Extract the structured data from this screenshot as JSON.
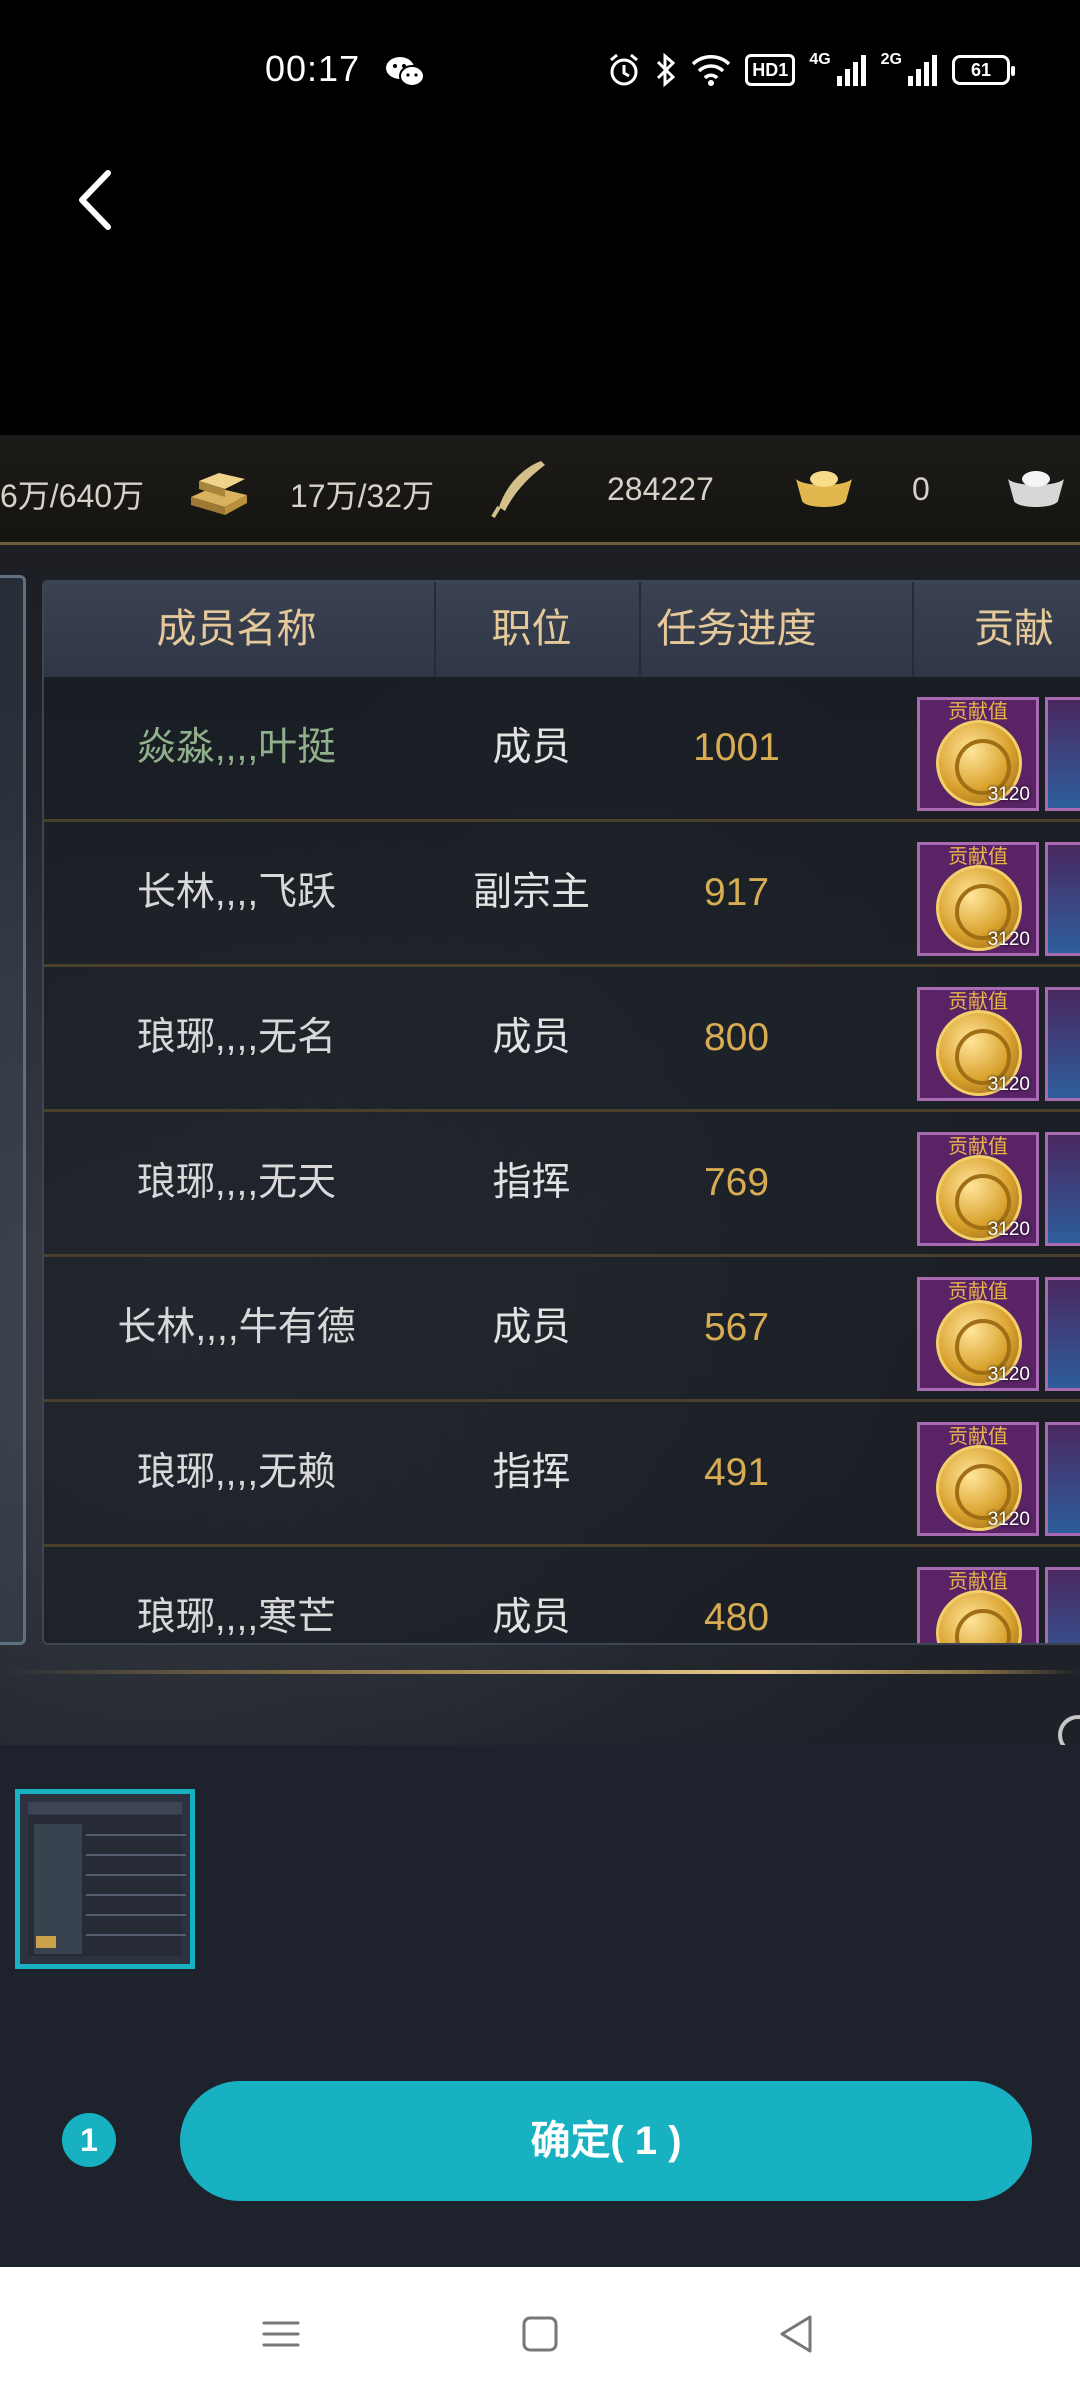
{
  "status_bar": {
    "time": "00:17",
    "network_4g": "4G",
    "network_2g": "2G",
    "battery": "61",
    "hd": "HD1"
  },
  "resources": {
    "r1": "6万/640万",
    "r2": "17万/32万",
    "r3": "284227",
    "r4": "0"
  },
  "table": {
    "headers": [
      "成员名称",
      "职位",
      "任务进度",
      "贡献"
    ],
    "medal_label": "贡献值",
    "rows": [
      {
        "name": "焱淼,,,,叶挺",
        "role": "成员",
        "progress": "1001",
        "medal_count": "3120"
      },
      {
        "name": "长林,,,,飞跃",
        "role": "副宗主",
        "progress": "917",
        "medal_count": "3120"
      },
      {
        "name": "琅琊,,,,无名",
        "role": "成员",
        "progress": "800",
        "medal_count": "3120"
      },
      {
        "name": "琅琊,,,,无天",
        "role": "指挥",
        "progress": "769",
        "medal_count": "3120"
      },
      {
        "name": "长林,,,,牛有德",
        "role": "成员",
        "progress": "567",
        "medal_count": "3120"
      },
      {
        "name": "琅琊,,,,无赖",
        "role": "指挥",
        "progress": "491",
        "medal_count": "3120"
      },
      {
        "name": "琅琊,,,,寒芒",
        "role": "成员",
        "progress": "480",
        "medal_count": ""
      }
    ]
  },
  "selection": {
    "count": "1",
    "confirm_label": "确定( 1 )"
  },
  "colors": {
    "accent": "#17b1c2",
    "progress_text": "#d7ac52",
    "header_text": "#e6c99a"
  }
}
